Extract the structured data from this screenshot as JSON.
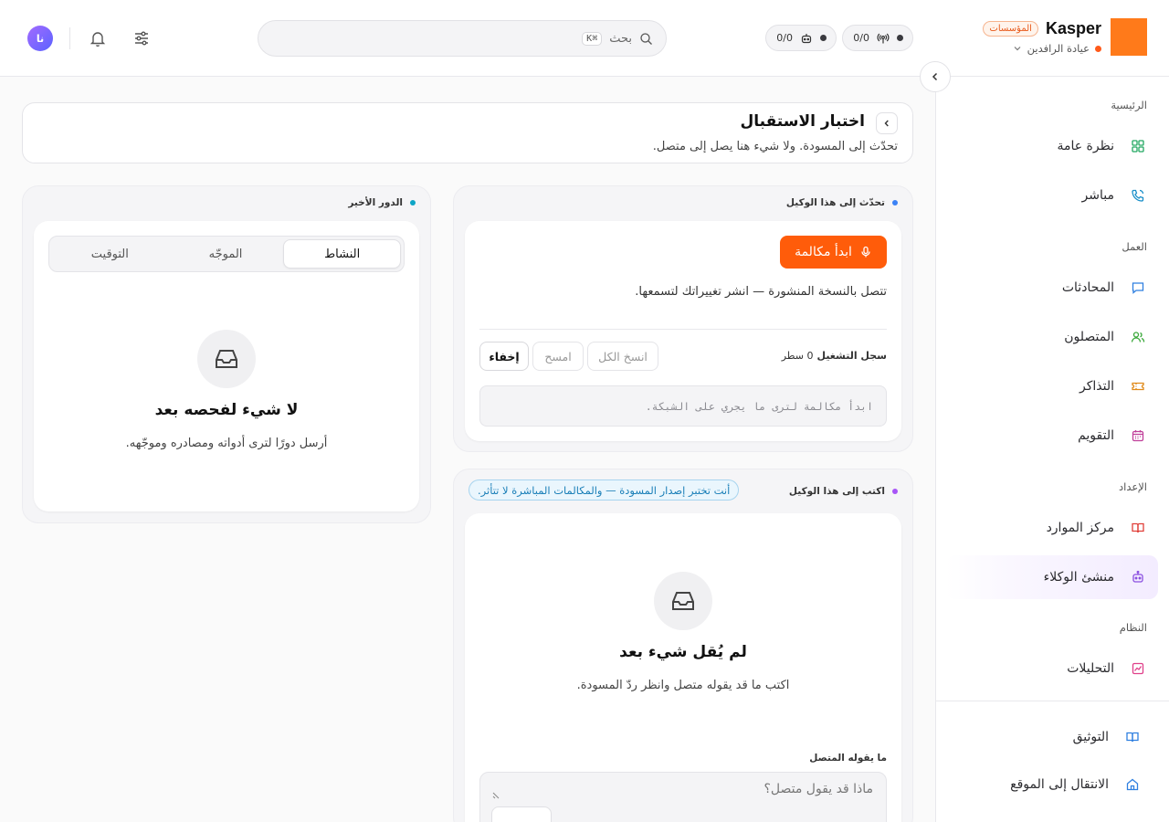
{
  "brand": {
    "name": "Kasper",
    "org_badge": "المؤسسات",
    "workspace": "عيادة الرافدين"
  },
  "status": {
    "channels_count": "0/0",
    "agents_count": "0/0"
  },
  "search": {
    "label": "بحث",
    "shortcut": "⌘K"
  },
  "user": {
    "initials": "نا"
  },
  "sidebar": {
    "sections": {
      "home": "الرئيسية",
      "work": "العمل",
      "setup": "الإعداد",
      "system": "النظام"
    },
    "items": {
      "overview": "نظرة عامة",
      "live": "مباشر",
      "conversations": "المحادثات",
      "contacts": "المتصلون",
      "tickets": "التذاكر",
      "calendar": "التقويم",
      "resources": "مركز الموارد",
      "agent_builder": "منشئ الوكلاء",
      "analytics": "التحليلات",
      "docs": "التوثيق",
      "go_to_site": "الانتقال إلى الموقع"
    }
  },
  "page": {
    "title": "اختبار الاستقبال",
    "subtitle": "تحدّث إلى المسودة. ولا شيء هنا يصل إلى متصل."
  },
  "talk_panel": {
    "label": "تحدّث إلى هذا الوكيل",
    "start_call": "ابدأ مكالمة",
    "note": "تتصل بالنسخة المنشورة — انشر تغييراتك لتسمعها.",
    "log_title": "سجل التشغيل",
    "log_count": "0 سطر",
    "copy_all": "انسخ الكل",
    "clear": "امسح",
    "hide": "إخفاء",
    "log_placeholder": "ابدأ مكالمة لترى ما يجري على الشبكة."
  },
  "write_panel": {
    "label": "اكتب إلى هذا الوكيل",
    "info": "أنت تختبر إصدار المسودة — والمكالمات المباشرة لا تتأثر.",
    "empty_title": "لم يُقل شيء بعد",
    "empty_sub": "اكتب ما قد يقوله متصل وانظر ردّ المسودة.",
    "field_label": "ما يقوله المتصل",
    "input_placeholder": "ماذا قد يقول متصل؟"
  },
  "turn_panel": {
    "label": "الدور الأخير",
    "tabs": [
      "النشاط",
      "الموجّه",
      "التوقيت"
    ],
    "active_tab": "النشاط",
    "empty_title": "لا شيء لفحصه بعد",
    "empty_sub": "أرسل دورًا لترى أدواته ومصادره وموجّهه."
  },
  "colors": {
    "accent": "#ff5c0a",
    "brand_logo": "#ff7a1a",
    "talk_dot": "#3b82f6",
    "write_dot": "#a855f7",
    "turn_dot": "#0ea5c6",
    "info_chip": "#1a7fb8"
  },
  "icons": {
    "overview": "grid-icon",
    "live": "phone-icon",
    "conversations": "chat-icon",
    "contacts": "users-icon",
    "tickets": "ticket-icon",
    "calendar": "calendar-icon",
    "resources": "book-icon",
    "agent_builder": "robot-icon",
    "analytics": "chart-icon",
    "docs": "book-open-icon",
    "go_to_site": "home-icon"
  }
}
